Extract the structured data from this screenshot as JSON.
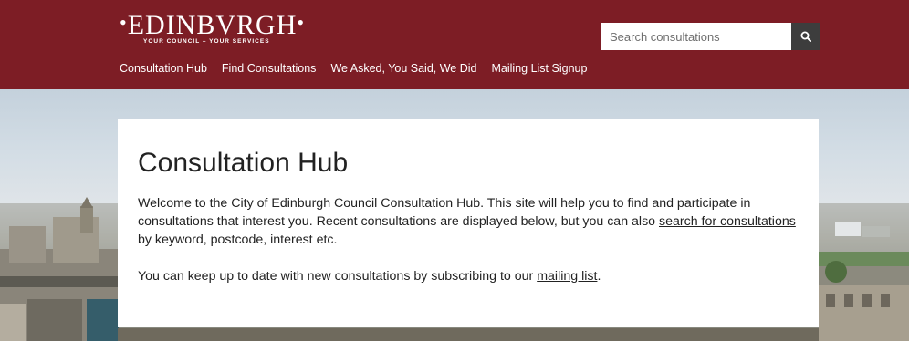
{
  "logo": {
    "name": "EDINBVRGH",
    "tagline": "YOUR COUNCIL – YOUR SERVICES"
  },
  "search": {
    "placeholder": "Search consultations",
    "button_icon": "search-icon"
  },
  "nav": {
    "items": [
      {
        "label": "Consultation Hub"
      },
      {
        "label": "Find Consultations"
      },
      {
        "label": "We Asked, You Said, We Did"
      },
      {
        "label": "Mailing List Signup"
      }
    ]
  },
  "main": {
    "title": "Consultation Hub",
    "intro_text_1": "Welcome to the City of Edinburgh Council Consultation Hub. This site will help you to find and participate in consultations that interest you. Recent consultations are displayed below, but you can also ",
    "intro_link": "search for consultations",
    "intro_text_2": " by keyword, postcode, interest etc.",
    "mailing_text": "You can keep up to date with new consultations by subscribing to our ",
    "mailing_link": "mailing list",
    "mailing_end": "."
  },
  "colors": {
    "header_bg": "#7d1d25",
    "search_button_bg": "#3d3d3d"
  }
}
